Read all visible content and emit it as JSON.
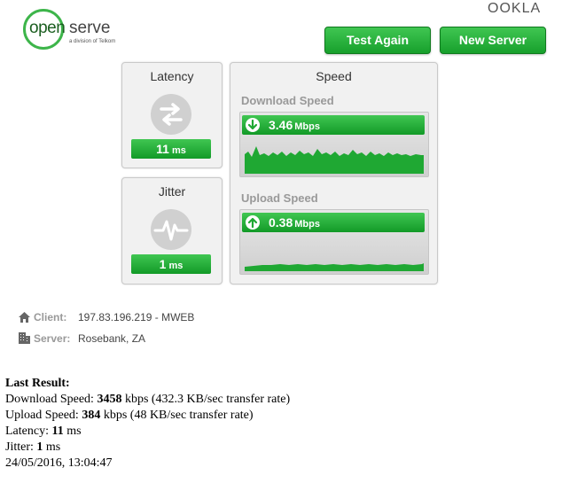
{
  "header": {
    "logo_open": "open",
    "logo_serve": "serve",
    "logo_sub": "a division of Telkom",
    "ookla": "OOKLA",
    "test_again_label": "Test Again",
    "new_server_label": "New Server"
  },
  "latency": {
    "title": "Latency",
    "value": "11",
    "unit": "ms"
  },
  "jitter": {
    "title": "Jitter",
    "value": "1",
    "unit": "ms"
  },
  "speed": {
    "title": "Speed",
    "download_label": "Download Speed",
    "download_value": "3.46",
    "download_unit": "Mbps",
    "upload_label": "Upload Speed",
    "upload_value": "0.38",
    "upload_unit": "Mbps"
  },
  "info": {
    "client_label": "Client:",
    "client_value": "197.83.196.219 - MWEB",
    "server_label": "Server:",
    "server_value": "Rosebank, ZA"
  },
  "last_result": {
    "heading": "Last Result:",
    "download_prefix": "Download Speed: ",
    "download_kbps": "3458",
    "download_suffix": " kbps (432.3 KB/sec transfer rate)",
    "upload_prefix": "Upload Speed: ",
    "upload_kbps": "384",
    "upload_suffix": " kbps (48 KB/sec transfer rate)",
    "latency_prefix": "Latency: ",
    "latency_value": "11",
    "latency_suffix": " ms",
    "jitter_prefix": "Jitter: ",
    "jitter_value": "1",
    "jitter_suffix": " ms",
    "timestamp": "24/05/2016, 13:04:47"
  },
  "colors": {
    "accent_green": "#1fa833",
    "panel_bg": "#f1f1f1"
  }
}
